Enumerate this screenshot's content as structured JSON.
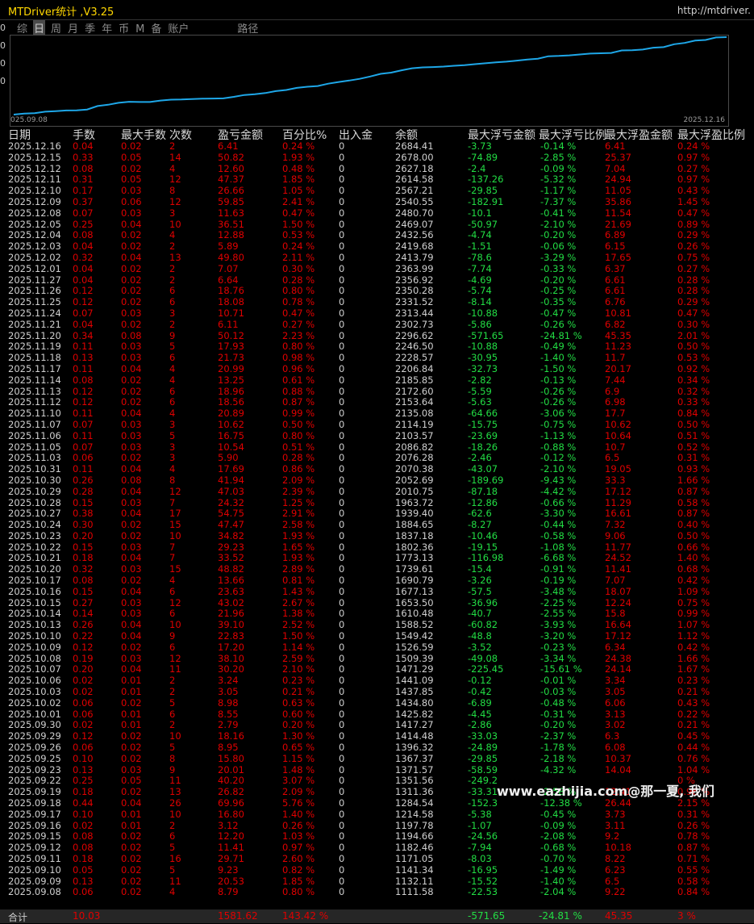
{
  "window": {
    "title": "MTDriver统计 ,V3.25",
    "url": "http://mtdriver."
  },
  "tabs": [
    {
      "label": "综",
      "active": false
    },
    {
      "label": "日",
      "active": true
    },
    {
      "label": "周",
      "active": false
    },
    {
      "label": "月",
      "active": false
    },
    {
      "label": "季",
      "active": false
    },
    {
      "label": "年",
      "active": false
    },
    {
      "label": "币",
      "active": false
    },
    {
      "label": "M",
      "active": false
    },
    {
      "label": "备",
      "active": false
    },
    {
      "label": "账户",
      "active": false
    },
    {
      "label": "路径",
      "active": false
    }
  ],
  "left_edge": [
    "0",
    "0",
    "0",
    "0"
  ],
  "chart_data": {
    "type": "line",
    "x_start_label": "025.09.08",
    "x_end_label": "2025.12.16",
    "series_color": "#1ea7e8",
    "x": [
      "2025.09.08",
      "2025.09.09",
      "2025.09.10",
      "2025.09.11",
      "2025.09.12",
      "2025.09.15",
      "2025.09.16",
      "2025.09.17",
      "2025.09.18",
      "2025.09.19",
      "2025.09.22",
      "2025.09.23",
      "2025.09.24",
      "2025.09.25",
      "2025.09.26",
      "2025.09.29",
      "2025.09.30",
      "2025.10.01",
      "2025.10.02",
      "2025.10.03",
      "2025.10.06",
      "2025.10.07",
      "2025.10.08",
      "2025.10.09",
      "2025.10.10",
      "2025.10.13",
      "2025.10.14",
      "2025.10.15",
      "2025.10.16",
      "2025.10.17",
      "2025.10.20",
      "2025.10.21",
      "2025.10.22",
      "2025.10.23",
      "2025.10.24",
      "2025.10.27",
      "2025.10.28",
      "2025.10.29",
      "2025.10.30",
      "2025.10.31",
      "2025.11.03",
      "2025.11.05",
      "2025.11.06",
      "2025.11.07",
      "2025.11.10",
      "2025.11.12",
      "2025.11.13",
      "2025.11.14",
      "2025.11.17",
      "2025.11.18",
      "2025.11.19",
      "2025.11.20",
      "2025.11.21",
      "2025.11.24",
      "2025.11.25",
      "2025.11.26",
      "2025.11.27",
      "2025.12.01",
      "2025.12.02",
      "2025.12.03",
      "2025.12.04",
      "2025.12.05",
      "2025.12.08",
      "2025.12.09",
      "2025.12.10",
      "2025.12.11",
      "2025.12.12",
      "2025.12.15",
      "2025.12.16"
    ],
    "values": [
      1111.58,
      1132.11,
      1141.34,
      1171.05,
      1182.46,
      1194.66,
      1197.78,
      1214.58,
      1284.54,
      1311.36,
      1351.56,
      1371.57,
      1367.37,
      1367.37,
      1396.32,
      1414.48,
      1417.27,
      1425.82,
      1434.8,
      1437.85,
      1441.09,
      1471.29,
      1509.39,
      1526.59,
      1549.42,
      1588.52,
      1610.48,
      1653.5,
      1677.13,
      1690.79,
      1739.61,
      1773.13,
      1802.36,
      1837.18,
      1884.65,
      1939.4,
      1963.72,
      2010.75,
      2052.69,
      2070.38,
      2076.28,
      2086.82,
      2103.57,
      2114.19,
      2135.08,
      2153.64,
      2172.6,
      2185.85,
      2206.84,
      2228.57,
      2246.5,
      2296.62,
      2302.73,
      2313.44,
      2331.52,
      2350.28,
      2356.92,
      2363.99,
      2413.79,
      2419.68,
      2432.56,
      2469.07,
      2480.7,
      2540.55,
      2567.21,
      2614.58,
      2627.18,
      2678.0,
      2684.41
    ]
  },
  "table": {
    "headers": [
      "日期",
      "手数",
      "最大手数",
      "次数",
      "盈亏金额",
      "百分比%",
      "出入金",
      "余额",
      "最大浮亏金额",
      "最大浮亏比例",
      "最大浮盈金额",
      "最大浮盈比例"
    ],
    "rows": [
      [
        "2025.12.16",
        "0.04",
        "0.02",
        "2",
        "6.41",
        "0.24 %",
        "0",
        "2684.41",
        "-3.73",
        "-0.14 %",
        "6.41",
        "0.24 %"
      ],
      [
        "2025.12.15",
        "0.33",
        "0.05",
        "14",
        "50.82",
        "1.93 %",
        "0",
        "2678.00",
        "-74.89",
        "-2.85 %",
        "25.37",
        "0.97 %"
      ],
      [
        "2025.12.12",
        "0.08",
        "0.02",
        "4",
        "12.60",
        "0.48 %",
        "0",
        "2627.18",
        "-2.4",
        "-0.09 %",
        "7.04",
        "0.27 %"
      ],
      [
        "2025.12.11",
        "0.31",
        "0.05",
        "12",
        "47.37",
        "1.85 %",
        "0",
        "2614.58",
        "-137.26",
        "-5.32 %",
        "24.94",
        "0.97 %"
      ],
      [
        "2025.12.10",
        "0.17",
        "0.03",
        "8",
        "26.66",
        "1.05 %",
        "0",
        "2567.21",
        "-29.85",
        "-1.17 %",
        "11.05",
        "0.43 %"
      ],
      [
        "2025.12.09",
        "0.37",
        "0.06",
        "12",
        "59.85",
        "2.41 %",
        "0",
        "2540.55",
        "-182.91",
        "-7.37 %",
        "35.86",
        "1.45 %"
      ],
      [
        "2025.12.08",
        "0.07",
        "0.03",
        "3",
        "11.63",
        "0.47 %",
        "0",
        "2480.70",
        "-10.1",
        "-0.41 %",
        "11.54",
        "0.47 %"
      ],
      [
        "2025.12.05",
        "0.25",
        "0.04",
        "10",
        "36.51",
        "1.50 %",
        "0",
        "2469.07",
        "-50.97",
        "-2.10 %",
        "21.69",
        "0.89 %"
      ],
      [
        "2025.12.04",
        "0.08",
        "0.02",
        "4",
        "12.88",
        "0.53 %",
        "0",
        "2432.56",
        "-4.74",
        "-0.20 %",
        "6.89",
        "0.29 %"
      ],
      [
        "2025.12.03",
        "0.04",
        "0.02",
        "2",
        "5.89",
        "0.24 %",
        "0",
        "2419.68",
        "-1.51",
        "-0.06 %",
        "6.15",
        "0.26 %"
      ],
      [
        "2025.12.02",
        "0.32",
        "0.04",
        "13",
        "49.80",
        "2.11 %",
        "0",
        "2413.79",
        "-78.6",
        "-3.29 %",
        "17.65",
        "0.75 %"
      ],
      [
        "2025.12.01",
        "0.04",
        "0.02",
        "2",
        "7.07",
        "0.30 %",
        "0",
        "2363.99",
        "-7.74",
        "-0.33 %",
        "6.37",
        "0.27 %"
      ],
      [
        "2025.11.27",
        "0.04",
        "0.02",
        "2",
        "6.64",
        "0.28 %",
        "0",
        "2356.92",
        "-4.69",
        "-0.20 %",
        "6.61",
        "0.28 %"
      ],
      [
        "2025.11.26",
        "0.12",
        "0.02",
        "6",
        "18.76",
        "0.80 %",
        "0",
        "2350.28",
        "-5.74",
        "-0.25 %",
        "6.61",
        "0.28 %"
      ],
      [
        "2025.11.25",
        "0.12",
        "0.02",
        "6",
        "18.08",
        "0.78 %",
        "0",
        "2331.52",
        "-8.14",
        "-0.35 %",
        "6.76",
        "0.29 %"
      ],
      [
        "2025.11.24",
        "0.07",
        "0.03",
        "3",
        "10.71",
        "0.47 %",
        "0",
        "2313.44",
        "-10.88",
        "-0.47 %",
        "10.81",
        "0.47 %"
      ],
      [
        "2025.11.21",
        "0.04",
        "0.02",
        "2",
        "6.11",
        "0.27 %",
        "0",
        "2302.73",
        "-5.86",
        "-0.26 %",
        "6.82",
        "0.30 %"
      ],
      [
        "2025.11.20",
        "0.34",
        "0.08",
        "9",
        "50.12",
        "2.23 %",
        "0",
        "2296.62",
        "-571.65",
        "-24.81 %",
        "45.35",
        "2.01 %"
      ],
      [
        "2025.11.19",
        "0.11",
        "0.03",
        "5",
        "17.93",
        "0.80 %",
        "0",
        "2246.50",
        "-10.88",
        "-0.49 %",
        "11.23",
        "0.50 %"
      ],
      [
        "2025.11.18",
        "0.13",
        "0.03",
        "6",
        "21.73",
        "0.98 %",
        "0",
        "2228.57",
        "-30.95",
        "-1.40 %",
        "11.7",
        "0.53 %"
      ],
      [
        "2025.11.17",
        "0.11",
        "0.04",
        "4",
        "20.99",
        "0.96 %",
        "0",
        "2206.84",
        "-32.73",
        "-1.50 %",
        "20.17",
        "0.92 %"
      ],
      [
        "2025.11.14",
        "0.08",
        "0.02",
        "4",
        "13.25",
        "0.61 %",
        "0",
        "2185.85",
        "-2.82",
        "-0.13 %",
        "7.44",
        "0.34 %"
      ],
      [
        "2025.11.13",
        "0.12",
        "0.02",
        "6",
        "18.96",
        "0.88 %",
        "0",
        "2172.60",
        "-5.59",
        "-0.26 %",
        "6.9",
        "0.32 %"
      ],
      [
        "2025.11.12",
        "0.12",
        "0.02",
        "6",
        "18.56",
        "0.87 %",
        "0",
        "2153.64",
        "-5.63",
        "-0.26 %",
        "6.98",
        "0.33 %"
      ],
      [
        "2025.11.10",
        "0.11",
        "0.04",
        "4",
        "20.89",
        "0.99 %",
        "0",
        "2135.08",
        "-64.66",
        "-3.06 %",
        "17.7",
        "0.84 %"
      ],
      [
        "2025.11.07",
        "0.07",
        "0.03",
        "3",
        "10.62",
        "0.50 %",
        "0",
        "2114.19",
        "-15.75",
        "-0.75 %",
        "10.62",
        "0.50 %"
      ],
      [
        "2025.11.06",
        "0.11",
        "0.03",
        "5",
        "16.75",
        "0.80 %",
        "0",
        "2103.57",
        "-23.69",
        "-1.13 %",
        "10.64",
        "0.51 %"
      ],
      [
        "2025.11.05",
        "0.07",
        "0.03",
        "3",
        "10.54",
        "0.51 %",
        "0",
        "2086.82",
        "-18.26",
        "-0.88 %",
        "10.7",
        "0.52 %"
      ],
      [
        "2025.11.03",
        "0.06",
        "0.02",
        "3",
        "5.90",
        "0.28 %",
        "0",
        "2076.28",
        "-2.46",
        "-0.12 %",
        "6.5",
        "0.31 %"
      ],
      [
        "2025.10.31",
        "0.11",
        "0.04",
        "4",
        "17.69",
        "0.86 %",
        "0",
        "2070.38",
        "-43.07",
        "-2.10 %",
        "19.05",
        "0.93 %"
      ],
      [
        "2025.10.30",
        "0.26",
        "0.08",
        "8",
        "41.94",
        "2.09 %",
        "0",
        "2052.69",
        "-189.69",
        "-9.43 %",
        "33.3",
        "1.66 %"
      ],
      [
        "2025.10.29",
        "0.28",
        "0.04",
        "12",
        "47.03",
        "2.39 %",
        "0",
        "2010.75",
        "-87.18",
        "-4.42 %",
        "17.12",
        "0.87 %"
      ],
      [
        "2025.10.28",
        "0.15",
        "0.03",
        "7",
        "24.32",
        "1.25 %",
        "0",
        "1963.72",
        "-12.86",
        "-0.66 %",
        "11.29",
        "0.58 %"
      ],
      [
        "2025.10.27",
        "0.38",
        "0.04",
        "17",
        "54.75",
        "2.91 %",
        "0",
        "1939.40",
        "-62.6",
        "-3.30 %",
        "16.61",
        "0.87 %"
      ],
      [
        "2025.10.24",
        "0.30",
        "0.02",
        "15",
        "47.47",
        "2.58 %",
        "0",
        "1884.65",
        "-8.27",
        "-0.44 %",
        "7.32",
        "0.40 %"
      ],
      [
        "2025.10.23",
        "0.20",
        "0.02",
        "10",
        "34.82",
        "1.93 %",
        "0",
        "1837.18",
        "-10.46",
        "-0.58 %",
        "9.06",
        "0.50 %"
      ],
      [
        "2025.10.22",
        "0.15",
        "0.03",
        "7",
        "29.23",
        "1.65 %",
        "0",
        "1802.36",
        "-19.15",
        "-1.08 %",
        "11.77",
        "0.66 %"
      ],
      [
        "2025.10.21",
        "0.18",
        "0.04",
        "7",
        "33.52",
        "1.93 %",
        "0",
        "1773.13",
        "-116.98",
        "-6.68 %",
        "24.52",
        "1.40 %"
      ],
      [
        "2025.10.20",
        "0.32",
        "0.03",
        "15",
        "48.82",
        "2.89 %",
        "0",
        "1739.61",
        "-15.4",
        "-0.91 %",
        "11.41",
        "0.68 %"
      ],
      [
        "2025.10.17",
        "0.08",
        "0.02",
        "4",
        "13.66",
        "0.81 %",
        "0",
        "1690.79",
        "-3.26",
        "-0.19 %",
        "7.07",
        "0.42 %"
      ],
      [
        "2025.10.16",
        "0.15",
        "0.04",
        "6",
        "23.63",
        "1.43 %",
        "0",
        "1677.13",
        "-57.5",
        "-3.48 %",
        "18.07",
        "1.09 %"
      ],
      [
        "2025.10.15",
        "0.27",
        "0.03",
        "12",
        "43.02",
        "2.67 %",
        "0",
        "1653.50",
        "-36.96",
        "-2.25 %",
        "12.24",
        "0.75 %"
      ],
      [
        "2025.10.14",
        "0.14",
        "0.03",
        "6",
        "21.96",
        "1.38 %",
        "0",
        "1610.48",
        "-40.7",
        "-2.55 %",
        "15.8",
        "0.99 %"
      ],
      [
        "2025.10.13",
        "0.26",
        "0.04",
        "10",
        "39.10",
        "2.52 %",
        "0",
        "1588.52",
        "-60.82",
        "-3.93 %",
        "16.64",
        "1.07 %"
      ],
      [
        "2025.10.10",
        "0.22",
        "0.04",
        "9",
        "22.83",
        "1.50 %",
        "0",
        "1549.42",
        "-48.8",
        "-3.20 %",
        "17.12",
        "1.12 %"
      ],
      [
        "2025.10.09",
        "0.12",
        "0.02",
        "6",
        "17.20",
        "1.14 %",
        "0",
        "1526.59",
        "-3.52",
        "-0.23 %",
        "6.34",
        "0.42 %"
      ],
      [
        "2025.10.08",
        "0.19",
        "0.03",
        "12",
        "38.10",
        "2.59 %",
        "0",
        "1509.39",
        "-49.08",
        "-3.34 %",
        "24.38",
        "1.66 %"
      ],
      [
        "2025.10.07",
        "0.20",
        "0.04",
        "11",
        "30.20",
        "2.10 %",
        "0",
        "1471.29",
        "-225.45",
        "-15.61 %",
        "24.14",
        "1.67 %"
      ],
      [
        "2025.10.06",
        "0.02",
        "0.01",
        "2",
        "3.24",
        "0.23 %",
        "0",
        "1441.09",
        "-0.12",
        "-0.01 %",
        "3.34",
        "0.23 %"
      ],
      [
        "2025.10.03",
        "0.02",
        "0.01",
        "2",
        "3.05",
        "0.21 %",
        "0",
        "1437.85",
        "-0.42",
        "-0.03 %",
        "3.05",
        "0.21 %"
      ],
      [
        "2025.10.02",
        "0.06",
        "0.02",
        "5",
        "8.98",
        "0.63 %",
        "0",
        "1434.80",
        "-6.89",
        "-0.48 %",
        "6.06",
        "0.43 %"
      ],
      [
        "2025.10.01",
        "0.06",
        "0.01",
        "6",
        "8.55",
        "0.60 %",
        "0",
        "1425.82",
        "-4.45",
        "-0.31 %",
        "3.13",
        "0.22 %"
      ],
      [
        "2025.09.30",
        "0.02",
        "0.01",
        "2",
        "2.79",
        "0.20 %",
        "0",
        "1417.27",
        "-2.86",
        "-0.20 %",
        "3.02",
        "0.21 %"
      ],
      [
        "2025.09.29",
        "0.12",
        "0.02",
        "10",
        "18.16",
        "1.30 %",
        "0",
        "1414.48",
        "-33.03",
        "-2.37 %",
        "6.3",
        "0.45 %"
      ],
      [
        "2025.09.26",
        "0.06",
        "0.02",
        "5",
        "8.95",
        "0.65 %",
        "0",
        "1396.32",
        "-24.89",
        "-1.78 %",
        "6.08",
        "0.44 %"
      ],
      [
        "2025.09.25",
        "0.10",
        "0.02",
        "8",
        "15.80",
        "1.15 %",
        "0",
        "1367.37",
        "-29.85",
        "-2.18 %",
        "10.37",
        "0.76 %"
      ],
      [
        "2025.09.23",
        "0.13",
        "0.03",
        "9",
        "20.01",
        "1.48 %",
        "0",
        "1371.57",
        "-58.59",
        "-4.32 %",
        "14.04",
        "1.04 %"
      ],
      [
        "2025.09.22",
        "0.25",
        "0.05",
        "11",
        "40.20",
        "3.07 %",
        "0",
        "1351.56",
        "-249.2",
        "",
        "",
        "0 %"
      ],
      [
        "2025.09.19",
        "0.18",
        "0.02",
        "13",
        "26.82",
        "2.09 %",
        "0",
        "1311.36",
        "-33.31",
        "-2.58 %",
        "12.41",
        "0.96 %"
      ],
      [
        "2025.09.18",
        "0.44",
        "0.04",
        "26",
        "69.96",
        "5.76 %",
        "0",
        "1284.54",
        "-152.3",
        "-12.38 %",
        "26.44",
        "2.15 %"
      ],
      [
        "2025.09.17",
        "0.10",
        "0.01",
        "10",
        "16.80",
        "1.40 %",
        "0",
        "1214.58",
        "-5.38",
        "-0.45 %",
        "3.73",
        "0.31 %"
      ],
      [
        "2025.09.16",
        "0.02",
        "0.01",
        "2",
        "3.12",
        "0.26 %",
        "0",
        "1197.78",
        "-1.07",
        "-0.09 %",
        "3.11",
        "0.26 %"
      ],
      [
        "2025.09.15",
        "0.08",
        "0.02",
        "6",
        "12.20",
        "1.03 %",
        "0",
        "1194.66",
        "-24.56",
        "-2.08 %",
        "9.2",
        "0.78 %"
      ],
      [
        "2025.09.12",
        "0.08",
        "0.02",
        "5",
        "11.41",
        "0.97 %",
        "0",
        "1182.46",
        "-7.94",
        "-0.68 %",
        "10.18",
        "0.87 %"
      ],
      [
        "2025.09.11",
        "0.18",
        "0.02",
        "16",
        "29.71",
        "2.60 %",
        "0",
        "1171.05",
        "-8.03",
        "-0.70 %",
        "8.22",
        "0.71 %"
      ],
      [
        "2025.09.10",
        "0.05",
        "0.02",
        "5",
        "9.23",
        "0.82 %",
        "0",
        "1141.34",
        "-16.95",
        "-1.49 %",
        "6.23",
        "0.55 %"
      ],
      [
        "2025.09.09",
        "0.13",
        "0.02",
        "11",
        "20.53",
        "1.85 %",
        "0",
        "1132.11",
        "-15.52",
        "-1.40 %",
        "6.5",
        "0.58 %"
      ],
      [
        "2025.09.08",
        "0.06",
        "0.02",
        "4",
        "8.79",
        "0.80 %",
        "0",
        "1111.58",
        "-22.53",
        "-2.04 %",
        "9.22",
        "0.84 %"
      ]
    ],
    "total": [
      "合计",
      "10.03",
      "",
      "",
      "1581.62",
      "143.42 %",
      "",
      "",
      "-571.65",
      "-24.81 %",
      "45.35",
      "3 %"
    ]
  },
  "watermark": "www.eazhijia.com@那一夏, 我们"
}
